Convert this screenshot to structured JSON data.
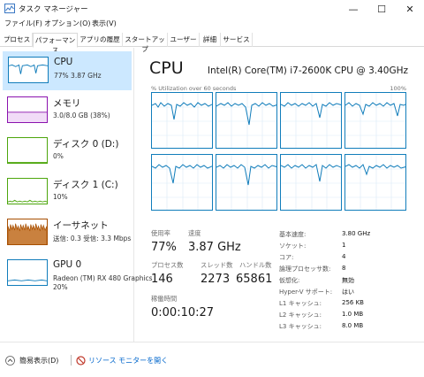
{
  "window": {
    "title": "タスク マネージャー",
    "minimize": "—",
    "maximize": "☐",
    "close": "✕"
  },
  "menu": [
    "ファイル(F)",
    "オプション(O)",
    "表示(V)"
  ],
  "tabs": [
    "プロセス",
    "パフォーマンス",
    "アプリの履歴",
    "スタートアップ",
    "ユーザー",
    "詳細",
    "サービス"
  ],
  "sidebar": {
    "cpu": {
      "title": "CPU",
      "sub": "77%  3.87 GHz"
    },
    "memory": {
      "title": "メモリ",
      "sub": "3.0/8.0 GB (38%)"
    },
    "disk0": {
      "title": "ディスク 0 (D:)",
      "sub": "0%"
    },
    "disk1": {
      "title": "ディスク 1 (C:)",
      "sub": "10%"
    },
    "ethernet": {
      "title": "イーサネット",
      "sub": "送信: 0.3  受信: 3.3 Mbps"
    },
    "gpu": {
      "title": "GPU 0",
      "sub": "Radeon (TM) RX 480 Graphics",
      "sub2": "20%"
    }
  },
  "main": {
    "title": "CPU",
    "model": "Intel(R) Core(TM) i7-2600K CPU @ 3.40GHz",
    "util_label": "% Utilization over 60 seconds",
    "util_max": "100%",
    "stats": {
      "usage_label": "使用率",
      "usage": "77%",
      "speed_label": "速度",
      "speed": "3.87 GHz",
      "processes_label": "プロセス数",
      "processes": "146",
      "threads_label": "スレッド数",
      "threads": "2273",
      "handles_label": "ハンドル数",
      "handles": "65861",
      "uptime_label": "稼働時間",
      "uptime": "0:00:10:27"
    },
    "details": [
      {
        "key": "基本速度:",
        "value": "3.80 GHz"
      },
      {
        "key": "ソケット:",
        "value": "1"
      },
      {
        "key": "コア:",
        "value": "4"
      },
      {
        "key": "論理プロセッサ数:",
        "value": "8"
      },
      {
        "key": "仮想化:",
        "value": "無効"
      },
      {
        "key": "Hyper-V サポート:",
        "value": "はい"
      },
      {
        "key": "L1 キャッシュ:",
        "value": "256 KB"
      },
      {
        "key": "L2 キャッシュ:",
        "value": "1.0 MB"
      },
      {
        "key": "L3 キャッシュ:",
        "value": "8.0 MB"
      }
    ]
  },
  "footer": {
    "compact": "簡易表示(D)",
    "resmon": "リソース モニターを開く"
  },
  "colors": {
    "cpu": "#117dbb",
    "memory": "#8b12ae",
    "disk": "#4da60c",
    "ethernet": "#a74f01",
    "selected": "#cce8ff",
    "link": "#0066cc"
  }
}
